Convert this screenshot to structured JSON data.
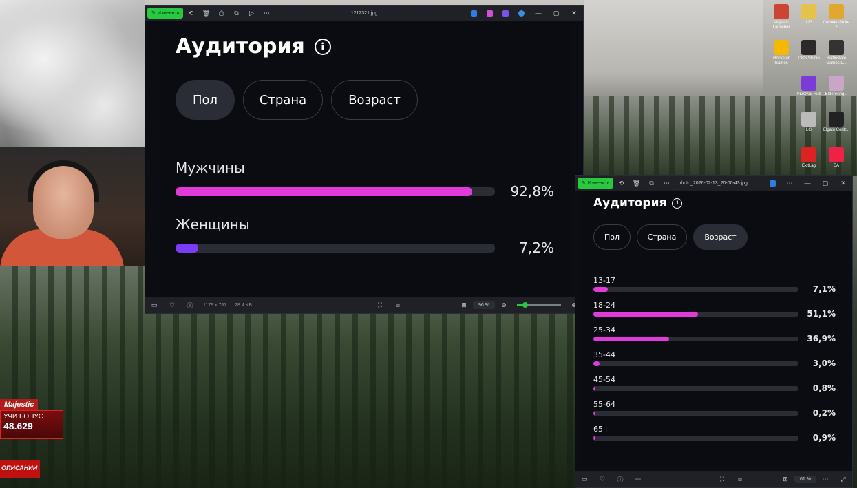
{
  "overlay": {
    "brand": "Majestic",
    "promo_text": "УЧИ БОНУС",
    "promo_number": "48.629",
    "desc": "ОПИСАНИИ"
  },
  "desktop_icons": [
    {
      "label": "Majestic Launcher",
      "color": "#c43"
    },
    {
      "label": "123",
      "color": "#e5c34a"
    },
    {
      "label": "Counter-Strike 2",
      "color": "#e0a82e"
    },
    {
      "label": "Rockstar Games",
      "color": "#f5b800"
    },
    {
      "label": "OBS Studio",
      "color": "#2a2a2a"
    },
    {
      "label": "Battlestate Games L...",
      "color": "#333"
    },
    {
      "label": "INZONE Hub",
      "color": "#7a3bd6"
    },
    {
      "label": "EldenRing...",
      "color": "#c9a5c8"
    },
    {
      "label": "LG",
      "color": "#bbb"
    },
    {
      "label": "Elgato Contr...",
      "color": "#222"
    },
    {
      "label": "ExitLag",
      "color": "#d22"
    },
    {
      "label": "EA",
      "color": "#e24"
    }
  ],
  "window1": {
    "edit_label": "Изменить",
    "filename": "1212321.jpg",
    "dimensions": "1179 x 787",
    "filesize": "28.4 KB",
    "zoom": "96 %",
    "heading": "Аудитория",
    "tabs": [
      "Пол",
      "Страна",
      "Возраст"
    ],
    "rows": [
      {
        "label": "Мужчины",
        "pct": "92,8%",
        "value": 92.8,
        "color": "#e03ad8"
      },
      {
        "label": "Женщины",
        "pct": "7,2%",
        "value": 7.2,
        "color": "#7a3cf5"
      }
    ]
  },
  "window2": {
    "edit_label": "Изменить",
    "filename": "photo_2026-02-13_20-00-43.jpg",
    "zoom": "61 %",
    "heading": "Аудитория",
    "tabs": [
      "Пол",
      "Страна",
      "Возраст"
    ],
    "rows": [
      {
        "label": "13-17",
        "pct": "7,1%",
        "value": 7.1
      },
      {
        "label": "18-24",
        "pct": "51,1%",
        "value": 51.1
      },
      {
        "label": "25-34",
        "pct": "36,9%",
        "value": 36.9
      },
      {
        "label": "35-44",
        "pct": "3,0%",
        "value": 3.0
      },
      {
        "label": "45-54",
        "pct": "0,8%",
        "value": 0.8
      },
      {
        "label": "55-64",
        "pct": "0,2%",
        "value": 0.2
      },
      {
        "label": "65+",
        "pct": "0,9%",
        "value": 0.9
      }
    ],
    "bar_color": "#e03ad8"
  }
}
